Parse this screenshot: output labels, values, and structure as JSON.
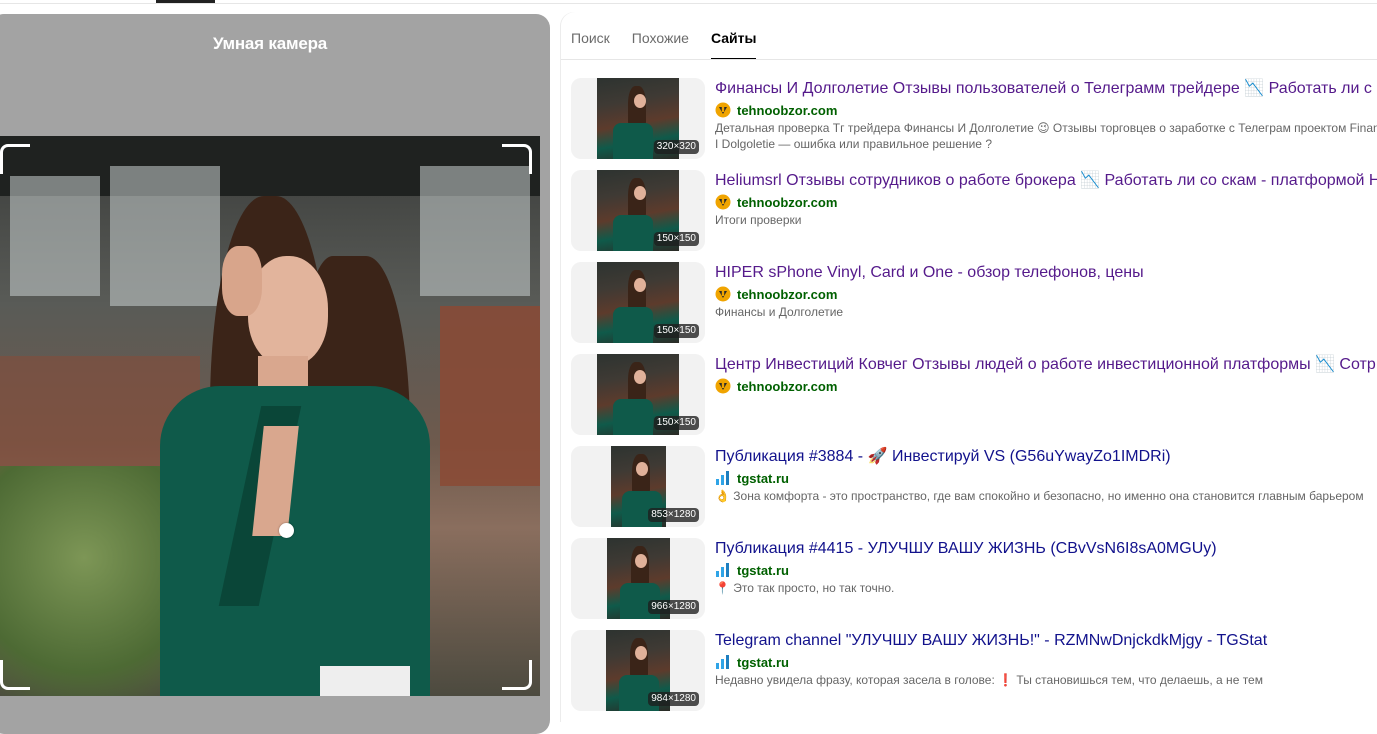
{
  "camera": {
    "title": "Умная камера"
  },
  "tabs": [
    {
      "label": "Поиск",
      "active": false
    },
    {
      "label": "Похожие",
      "active": false
    },
    {
      "label": "Сайты",
      "active": true
    }
  ],
  "results": [
    {
      "title": "Финансы И Долголетие Отзывы пользователей о Телеграмм трейдере 📉 Работать ли с",
      "site": "tehnoobzor.com",
      "favicon": "tehnoobzor-icon",
      "size": "320×320",
      "desc": "Детальная проверка Тг трейдера Финансы И Долголетие 😉 Отзывы торговцев о заработке с Телеграм проектом Finansy I Dolgoletie — ошибка или правильное решение ?"
    },
    {
      "title": "Heliumsrl Отзывы сотрудников о работе брокера 📉 Работать ли со скам - платформой Н",
      "site": "tehnoobzor.com",
      "favicon": "tehnoobzor-icon",
      "size": "150×150",
      "desc": "Итоги проверки"
    },
    {
      "title": "HIPER sPhone Vinyl, Card и One - обзор телефонов, цены",
      "site": "tehnoobzor.com",
      "favicon": "tehnoobzor-icon",
      "size": "150×150",
      "desc": "Финансы и Долголетие"
    },
    {
      "title": "Центр Инвестиций Ковчег Отзывы людей о работе инвестиционной платформы 📉 Сотр",
      "site": "tehnoobzor.com",
      "favicon": "tehnoobzor-icon",
      "size": "150×150",
      "desc": ""
    },
    {
      "title": "Публикация #3884 - 🚀 Инвестируй VS (G56uYwayZo1IMDRi)",
      "site": "tgstat.ru",
      "favicon": "tgstat-icon",
      "size": "853×1280",
      "desc": "👌 Зона комфорта - это пространство, где вам спокойно и безопасно, но именно она становится главным барьером"
    },
    {
      "title": "Публикация #4415 - УЛУЧШУ ВАШУ ЖИЗНЬ (CBvVsN6I8sA0MGUy)",
      "site": "tgstat.ru",
      "favicon": "tgstat-icon",
      "size": "966×1280",
      "desc": "📍 Это так просто, но так точно."
    },
    {
      "title": "Telegram channel \"УЛУЧШУ ВАШУ ЖИЗНЬ!\" - RZMNwDnjckdkMjgy - TGStat",
      "site": "tgstat.ru",
      "favicon": "tgstat-icon",
      "size": "984×1280",
      "desc": "Недавно увидела фразу, которая засела в голове: ❗ Ты становишься тем, что делаешь, а не тем"
    }
  ],
  "colors": {
    "visited_link": "#551a8b",
    "link": "#12128c",
    "domain": "#006000",
    "camera_bg": "#a3a3a3",
    "jacket": "#0f5a4a"
  }
}
